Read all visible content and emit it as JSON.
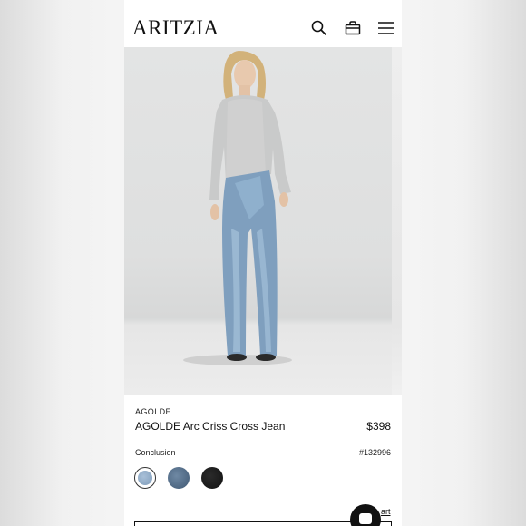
{
  "header": {
    "logo": "ARITZIA",
    "icons": [
      "search-icon",
      "bag-icon",
      "menu-icon"
    ]
  },
  "hero": {
    "image": "model-wearing-jeans-and-grey-sweater"
  },
  "product": {
    "brand": "AGOLDE",
    "name": "AGOLDE Arc Criss Cross Jean",
    "price": "$398",
    "color_name": "Conclusion",
    "style_number": "#132996",
    "swatches": [
      {
        "name": "light-wash",
        "color": "#8fa9c4",
        "selected": true
      },
      {
        "name": "medium-wash",
        "color": "#58718c",
        "selected": false
      },
      {
        "name": "black",
        "color": "#1a1a1a",
        "selected": false
      }
    ],
    "cart_link_partial": "art"
  },
  "colors": {
    "status_green": "#3cc85a",
    "text": "#111111"
  }
}
